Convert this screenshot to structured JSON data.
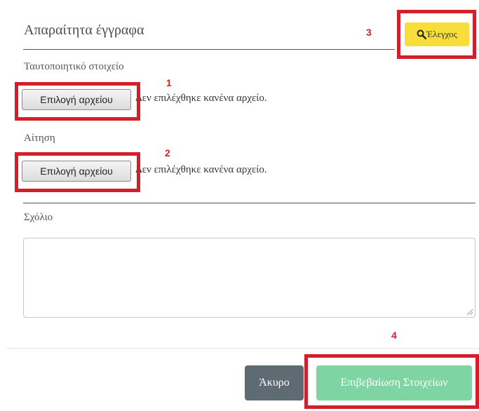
{
  "dialog": {
    "title": "Απαραίτητα έγγραφα",
    "check_button": {
      "label": "Έλεγχος",
      "icon": "search-icon",
      "color": "#f7de3a"
    }
  },
  "fields": [
    {
      "label": "Ταυτοποιητικό στοιχείο",
      "button_label": "Επιλογή αρχείου",
      "status": "Δεν επιλέχθηκε κανένα αρχείο."
    },
    {
      "label": "Αίτηση",
      "button_label": "Επιλογή αρχείου",
      "status": "Δεν επιλέχθηκε κανένα αρχείο."
    }
  ],
  "comment": {
    "label": "Σχόλιο",
    "value": "",
    "placeholder": ""
  },
  "footer": {
    "cancel_label": "Άκυρο",
    "confirm_label": "Επιβεβαίωση Στοιχείων",
    "cancel_color": "#5f6b73",
    "confirm_color": "#7ed4a3"
  },
  "annotations": {
    "color": "#d31f2a",
    "markers": [
      "1",
      "2",
      "3",
      "4"
    ]
  }
}
